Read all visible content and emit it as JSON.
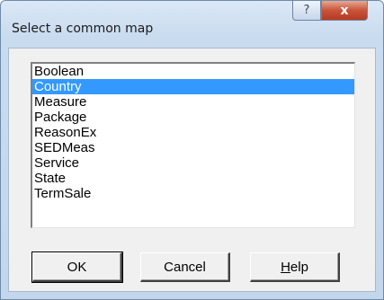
{
  "window": {
    "title": "Select a common map",
    "help_caption": "?",
    "close_caption": "x"
  },
  "listbox": {
    "selected_index": 1,
    "items": [
      "Boolean",
      "Country",
      "Measure",
      "Package",
      "ReasonEx",
      "SEDMeas",
      "Service",
      "State",
      "TermSale"
    ]
  },
  "buttons": {
    "ok_label": "OK",
    "cancel_label": "Cancel",
    "help_label_mnemonic": "H",
    "help_label_rest": "elp"
  },
  "colors": {
    "selection": "#3399ff",
    "close_button": "#c9543a"
  }
}
